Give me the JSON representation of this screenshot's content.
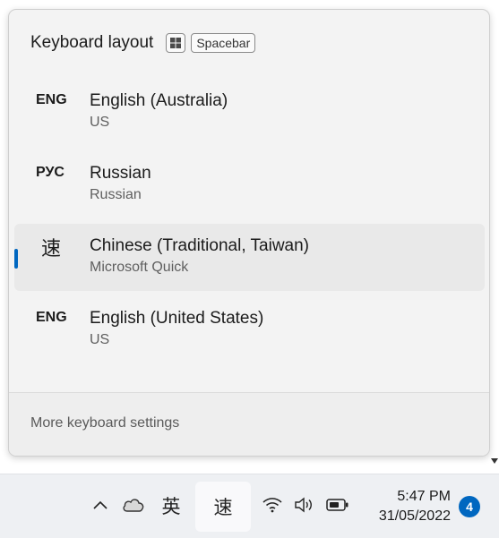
{
  "flyout": {
    "title": "Keyboard layout",
    "shortcut_key_label": "Spacebar",
    "shortcut_win_icon": "windows-logo-icon",
    "languages": [
      {
        "code": "ENG",
        "name": "English (Australia)",
        "layout": "US",
        "selected": false
      },
      {
        "code": "РУС",
        "name": "Russian",
        "layout": "Russian",
        "selected": false
      },
      {
        "code": "速",
        "name": "Chinese (Traditional, Taiwan)",
        "layout": "Microsoft Quick",
        "selected": true
      },
      {
        "code": "ENG",
        "name": "English (United States)",
        "layout": "US",
        "selected": false
      }
    ],
    "footer_link": "More keyboard settings"
  },
  "taskbar": {
    "icons": [
      "chevron-up-icon",
      "onedrive-cloud-icon",
      "wifi-icon",
      "volume-icon",
      "battery-icon"
    ],
    "ime_mode": "英",
    "ime_layout": "速",
    "time": "5:47 PM",
    "date": "31/05/2022",
    "notification_count": "4"
  },
  "colors": {
    "accent": "#0067c0",
    "flyout_bg": "#f3f3f3",
    "taskbar_bg": "#eef0f3"
  }
}
